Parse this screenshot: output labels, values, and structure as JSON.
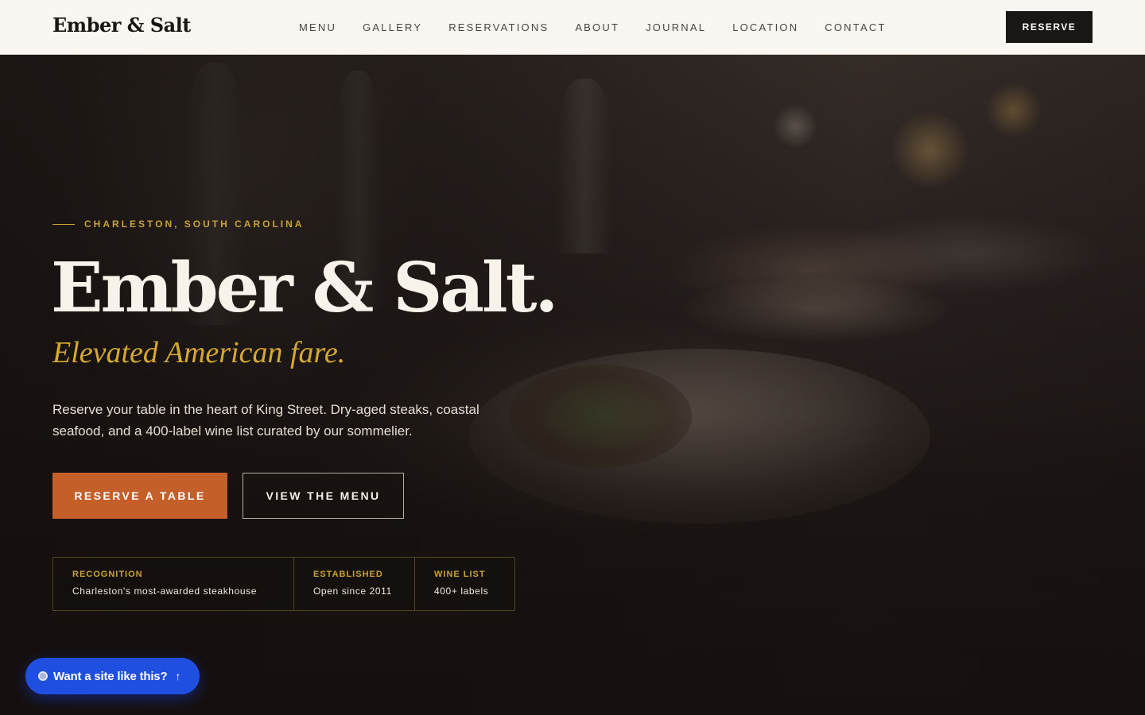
{
  "header": {
    "brand": "Ember & Salt",
    "nav": [
      "MENU",
      "GALLERY",
      "RESERVATIONS",
      "ABOUT",
      "JOURNAL",
      "LOCATION",
      "CONTACT"
    ],
    "reserve_label": "RESERVE"
  },
  "hero": {
    "eyebrow": "CHARLESTON, SOUTH CAROLINA",
    "title": "Ember & Salt.",
    "tagline": "Elevated American fare.",
    "description": "Reserve your table in the heart of King Street. Dry-aged steaks, coastal seafood, and a 400-label wine list curated by our sommelier.",
    "primary_cta": "RESERVE A TABLE",
    "secondary_cta": "VIEW THE MENU"
  },
  "stats": [
    {
      "label": "RECOGNITION",
      "value": "Charleston's most-awarded steakhouse"
    },
    {
      "label": "ESTABLISHED",
      "value": "Open since 2011"
    },
    {
      "label": "WINE LIST",
      "value": "400+ labels"
    }
  ],
  "floating_cta": {
    "label": "Want a site like this?",
    "arrow_icon": "arrow-up-icon"
  },
  "colors": {
    "accent_gold": "#c9a234",
    "primary_button": "#c45f2a",
    "header_bg": "#faf7f2",
    "floating_cta_bg": "#1f4fe0"
  }
}
